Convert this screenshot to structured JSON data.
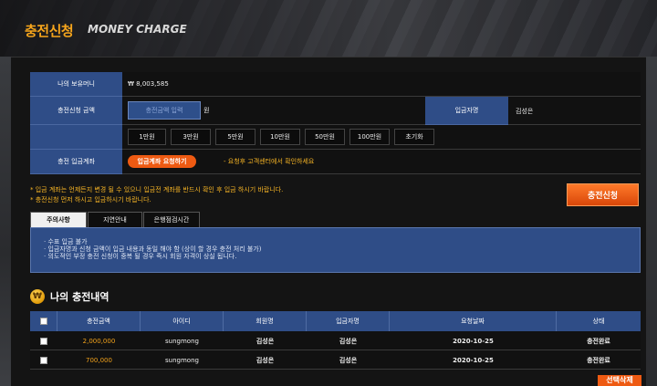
{
  "banner": {
    "title": "충전신청",
    "subtitle": "MONEY CHARGE"
  },
  "form": {
    "balance_label": "나의 보유머니",
    "balance_value": "₩ 8,003,585",
    "amount_label": "충전신청 금액",
    "amount_placeholder": "충전금액 입력",
    "amount_unit": "원",
    "depositor_label": "입금자명",
    "depositor_value": "김성은",
    "quick_amounts": [
      "1만원",
      "3만원",
      "5만원",
      "10만원",
      "50만원",
      "100만원",
      "초기화"
    ],
    "account_label": "충전 입금계좌",
    "request_account_button": "입금계좌 요청하기",
    "account_note": "- 요청후 고객센터에서 확인하세요"
  },
  "notices": [
    "* 입금 계좌는 언제든지 변경 될 수 있으니 입금전 계좌를 반드시 확인 후 입금 하시기 바랍니다.",
    "* 충전신청 먼저 하시고 입금하시기 바랍니다."
  ],
  "submit_button": "충전신청",
  "tabs": [
    "주의사항",
    "지연안내",
    "은행점검시간"
  ],
  "tab_content": [
    "·  수표 입금 불가",
    "·  입금자명과 신청 금액이 입금 내용과 동일 해야 함 (상이 할 경우 충전 처리 불가)",
    "·  의도적인 부정 충전 신청이 중복 될 경우 즉시 회원 자격이 상실 됩니다."
  ],
  "history": {
    "title": "나의 충전내역",
    "icon": "won-coin-icon",
    "columns": [
      "충전금액",
      "아이디",
      "회원명",
      "입금자명",
      "요청날짜",
      "상태"
    ],
    "rows": [
      [
        "2,000,000",
        "sungmong",
        "김성은",
        "김성은",
        "2020-10-25",
        "충전완료"
      ],
      [
        "700,000",
        "sungmong",
        "김성은",
        "김성은",
        "2020-10-25",
        "충전완료"
      ]
    ],
    "delete_button": "선택삭제"
  },
  "colors": {
    "accent": "#ee5a12",
    "header_blue": "#2f4d87",
    "gold": "#f2a21b"
  }
}
